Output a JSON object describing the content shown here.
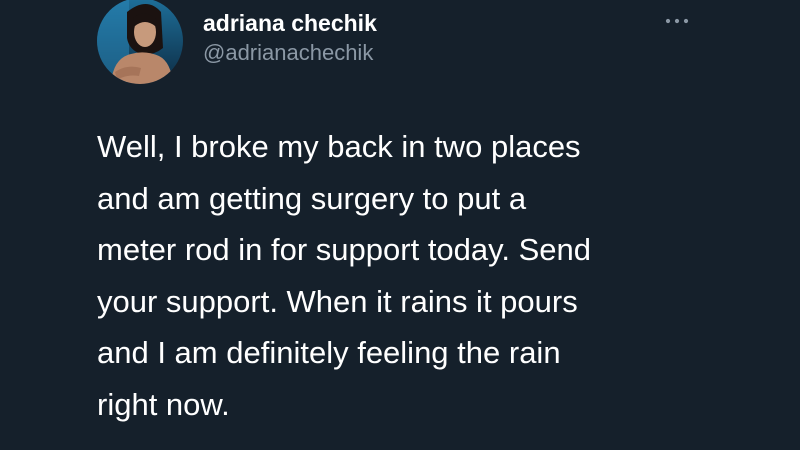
{
  "author": {
    "display_name": "adriana chechik",
    "handle": "@adrianachechik",
    "avatar_icon": "profile-photo"
  },
  "more_icon": "more-horizontal-icon",
  "tweet": {
    "lines": [
      "Well, I broke my back in two places",
      "and am getting surgery to put a",
      "meter rod in for support today. Send",
      "your support. When it rains it pours",
      "and I am definitely feeling the rain",
      "right now."
    ]
  },
  "colors": {
    "background": "#15202b",
    "primary_text": "#ffffff",
    "secondary_text": "#8b98a5"
  }
}
